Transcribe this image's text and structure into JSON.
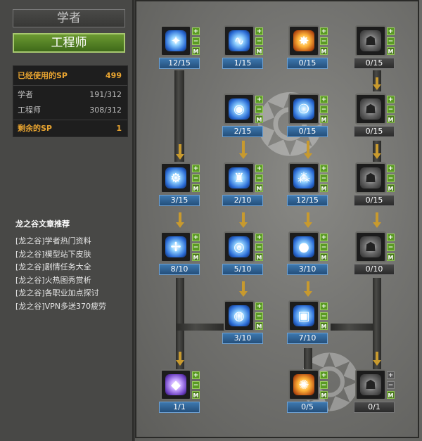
{
  "classes": {
    "scholar": "学者",
    "engineer": "工程师"
  },
  "sp": {
    "used_label": "已经使用的SP",
    "used_value": "499",
    "scholar_label": "学者",
    "scholar_value": "191/312",
    "engineer_label": "工程师",
    "engineer_value": "308/312",
    "remaining_label": "剩余的SP",
    "remaining_value": "1"
  },
  "recommend": {
    "title": "龙之谷文章推荐",
    "links": [
      "[龙之谷]学者热门资料",
      "[龙之谷]模型站下皮肤",
      "[龙之谷]剧情任务大全",
      "[龙之谷]火热图秀赏析",
      "[龙之谷]各职业加点探讨",
      "[龙之谷]VPN多送370疲劳"
    ]
  },
  "skills": [
    {
      "level": "12/15",
      "icon": "swirl-icon",
      "style": "blue",
      "btn": "active"
    },
    {
      "level": "1/15",
      "icon": "wave-icon",
      "style": "blue",
      "btn": "active"
    },
    {
      "level": "0/15",
      "icon": "flame-icon",
      "style": "fire",
      "btn": "active"
    },
    {
      "level": "0/15",
      "icon": "helmet-icon",
      "style": "grey",
      "btn": "active"
    },
    {
      "level": "2/15",
      "icon": "shield-orb-icon",
      "style": "blue",
      "btn": "active"
    },
    {
      "level": "0/15",
      "icon": "bubble-icon",
      "style": "blue",
      "btn": "active"
    },
    {
      "level": "0/15",
      "icon": "helmet-icon",
      "style": "grey",
      "btn": "active"
    },
    {
      "level": "3/15",
      "icon": "gear-icon",
      "style": "blue",
      "btn": "active"
    },
    {
      "level": "2/10",
      "icon": "robot-icon",
      "style": "blue",
      "btn": "active"
    },
    {
      "level": "12/15",
      "icon": "triple-orb-icon",
      "style": "blue",
      "btn": "active"
    },
    {
      "level": "0/15",
      "icon": "helmet-icon",
      "style": "grey",
      "btn": "active"
    },
    {
      "level": "8/10",
      "icon": "turret-icon",
      "style": "blue",
      "btn": "active"
    },
    {
      "level": "5/10",
      "icon": "barrier-icon",
      "style": "blue",
      "btn": "active"
    },
    {
      "level": "3/10",
      "icon": "droplet-icon",
      "style": "blue",
      "btn": "active"
    },
    {
      "level": "0/10",
      "icon": "helmet-icon",
      "style": "grey",
      "btn": "active"
    },
    {
      "level": "3/10",
      "icon": "vortex-icon",
      "style": "blue",
      "btn": "active"
    },
    {
      "level": "7/10",
      "icon": "mech-icon",
      "style": "blue",
      "btn": "active"
    },
    {
      "level": "1/1",
      "icon": "drill-icon",
      "style": "purple",
      "btn": "active"
    },
    {
      "level": "0/5",
      "icon": "burst-icon",
      "style": "fire",
      "btn": "active"
    },
    {
      "level": "0/1",
      "icon": "helmet-icon",
      "style": "grey",
      "btn": "disabled"
    }
  ],
  "colors": {
    "accent_green": "#6c9a32",
    "sp_gold": "#e8a430",
    "level_blue": "#3d78b0"
  }
}
